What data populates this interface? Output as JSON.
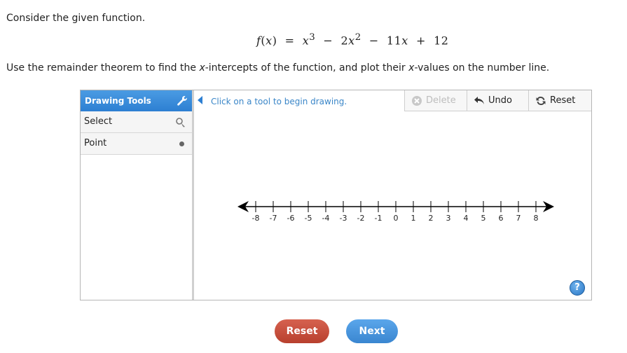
{
  "intro": "Consider the given function.",
  "equation": {
    "lhs_fn": "f",
    "lhs_var": "x",
    "rhs": [
      {
        "base": "x",
        "exp": "3"
      },
      {
        "op": "−"
      },
      {
        "coef": "2",
        "base": "x",
        "exp": "2"
      },
      {
        "op": "−"
      },
      {
        "coef": "11",
        "base": "x"
      },
      {
        "op": "+"
      },
      {
        "const": "12"
      }
    ]
  },
  "instruction": {
    "part1": "Use the remainder theorem to find the ",
    "em1": "x",
    "part2": "-intercepts of the function, and plot their ",
    "em2": "x",
    "part3": "-values on the number line."
  },
  "sidebar": {
    "title": "Drawing Tools",
    "tools": [
      {
        "label": "Select",
        "icon": "pointer-icon"
      },
      {
        "label": "Point",
        "icon": "point-dot-icon"
      }
    ]
  },
  "toolbar": {
    "hint": "Click on a tool to begin drawing.",
    "delete_label": "Delete",
    "undo_label": "Undo",
    "reset_label": "Reset"
  },
  "number_line": {
    "min": -8,
    "max": 8,
    "step": 1,
    "tick_labels": [
      "-8",
      "-7",
      "-6",
      "-5",
      "-4",
      "-3",
      "-2",
      "-1",
      "0",
      "1",
      "2",
      "3",
      "4",
      "5",
      "6",
      "7",
      "8"
    ]
  },
  "help_label": "?",
  "buttons": {
    "reset": "Reset",
    "next": "Next"
  },
  "colors": {
    "accent_blue": "#2d7fd2",
    "reset_red": "#c44c38",
    "next_blue": "#4a96df"
  }
}
